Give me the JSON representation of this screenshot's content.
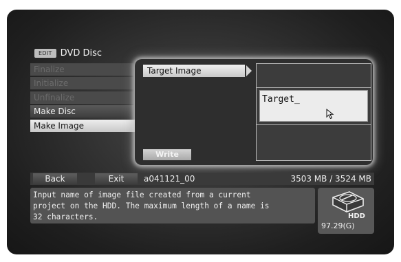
{
  "header": {
    "mode_tag": "EDIT",
    "title": "DVD Disc"
  },
  "menu": {
    "items": [
      {
        "label": "Finalize",
        "state": "disabled"
      },
      {
        "label": "Initialize",
        "state": "disabled"
      },
      {
        "label": "Unfinalize",
        "state": "disabled"
      },
      {
        "label": "Make Disc",
        "state": "enabled"
      },
      {
        "label": "Make Image",
        "state": "selected"
      }
    ]
  },
  "panel": {
    "target_label": "Target Image",
    "input_value": "Target_",
    "write_label": "Write"
  },
  "bottom_bar": {
    "back_label": "Back",
    "exit_label": "Exit",
    "file_name": "a041121_00",
    "disc_size": "3503 MB / 3524 MB"
  },
  "description": {
    "lines": [
      "Input name of image file created from a current",
      "project on the HDD. The maximum length of a name is",
      "32 characters."
    ]
  },
  "hdd": {
    "label": "HDD",
    "free_space": "97.29(G)",
    "icon": "hdd-icon"
  },
  "colors": {
    "background": "#2b2b2b",
    "selected_item": "#d9d9d9",
    "panel_glow": "#d2d2d2",
    "text_light": "#f0f0f0"
  }
}
